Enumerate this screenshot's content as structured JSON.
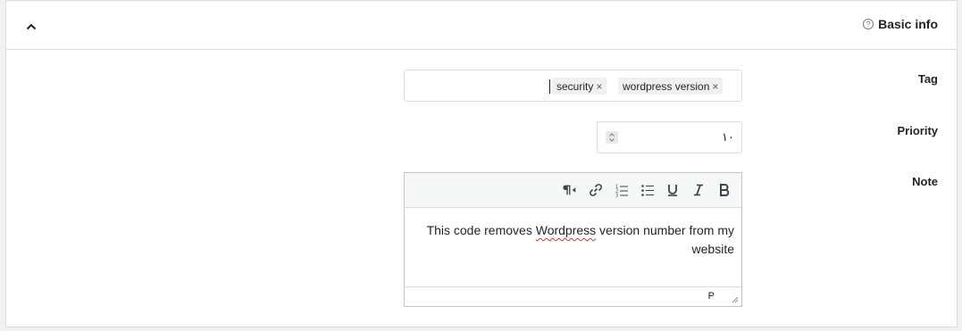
{
  "header": {
    "title": "Basic info",
    "help_icon": "?",
    "toggle_icon": "chevron-up-icon"
  },
  "tag": {
    "label": "Tag",
    "chips": [
      {
        "text": "wordpress version",
        "remove": "×"
      },
      {
        "text": "security",
        "remove": "×"
      }
    ]
  },
  "priority": {
    "label": "Priority",
    "value": "١٠"
  },
  "note": {
    "label": "Note",
    "toolbar": [
      "bold",
      "italic",
      "underline",
      "bulleted-list",
      "numbered-list",
      "link",
      "paragraph-rtl"
    ],
    "text_before": "This code removes ",
    "misspelled": "Wordpress",
    "text_after": " version number from my website",
    "status_path": "P"
  },
  "colors": {
    "border": "#dcdcde",
    "chip_bg": "#f0f0f1",
    "spell_error": "#d63638"
  }
}
